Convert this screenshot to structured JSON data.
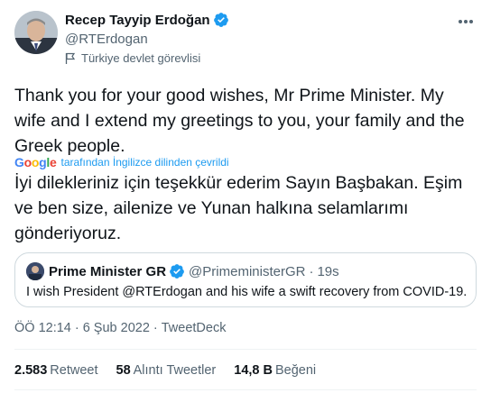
{
  "author": {
    "display_name": "Recep Tayyip Erdoğan",
    "handle": "@RTErdogan",
    "affiliation": "Türkiye devlet görevlisi"
  },
  "tweet": {
    "text": "Thank you for your good wishes, Mr Prime Minister. My wife and I extend my greetings to you, your family and the Greek people.",
    "translation_brand": "Google",
    "translation_label": "tarafından İngilizce dilinden çevrildi",
    "translated_text": "İyi dilekleriniz için teşekkür ederim Sayın Başbakan. Eşim ve ben size, ailenize ve Yunan halkına selamlarımı gönderiyoruz."
  },
  "quoted_tweet": {
    "display_name": "Prime Minister GR",
    "handle": "@PrimeministerGR",
    "separator": "·",
    "age": "19s",
    "text": "I wish President @RTErdogan and his wife a swift recovery from COVID-19."
  },
  "meta": {
    "time": "ÖÖ 12:14",
    "separator": "·",
    "date": "6 Şub 2022",
    "source": "TweetDeck"
  },
  "stats": {
    "retweets_count": "2.583",
    "retweets_label": "Retweet",
    "quotes_count": "58",
    "quotes_label": "Alıntı Tweetler",
    "likes_count": "14,8 B",
    "likes_label": "Beğeni"
  },
  "colors": {
    "accent": "#1d9bf0",
    "text": "#0f1419",
    "secondary": "#536471",
    "border": "#cfd9de"
  },
  "icons": [
    "verified-badge-icon",
    "flag-icon",
    "more-options-icon"
  ]
}
